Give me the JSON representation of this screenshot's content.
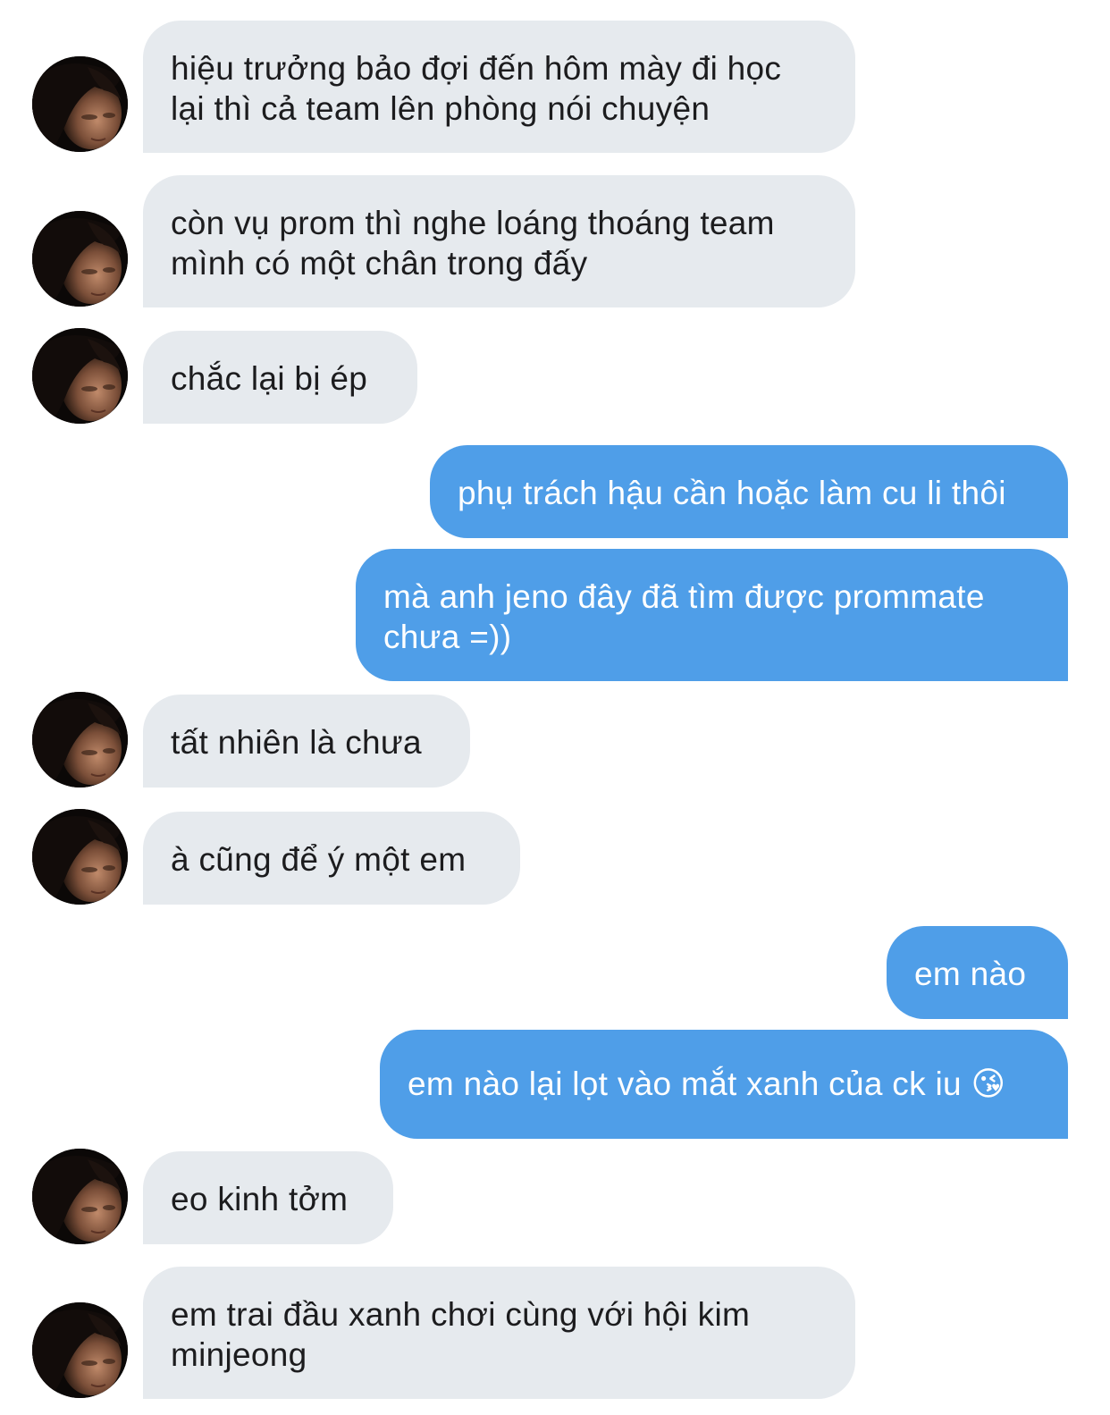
{
  "messages": [
    {
      "side": "in",
      "text": "hiệu trưởng bảo đợi đến hôm mày đi học\nlại thì cả team lên phòng nói chuyện"
    },
    {
      "side": "in",
      "text": "còn vụ prom thì nghe loáng thoáng team\nmình có một chân trong đấy"
    },
    {
      "side": "in",
      "text": "chắc lại bị ép"
    },
    {
      "side": "out",
      "text": "phụ trách hậu cần hoặc làm cu li thôi"
    },
    {
      "side": "out",
      "text": "mà anh jeno đây đã tìm được prommate\nchưa =))"
    },
    {
      "side": "in",
      "text": "tất nhiên là chưa"
    },
    {
      "side": "in",
      "text": "à cũng để ý một em"
    },
    {
      "side": "out",
      "text": "em nào"
    },
    {
      "side": "out",
      "text": "em nào lại lọt vào mắt xanh của ck iu 😘"
    },
    {
      "side": "in",
      "text": "eo kinh tởm"
    },
    {
      "side": "in",
      "text": "em trai đầu xanh chơi cùng với hội kim\nminjeong"
    }
  ],
  "colors": {
    "incoming_bubble": "#e6eaee",
    "outgoing_bubble": "#4f9ee8",
    "incoming_text": "#1c1c1e",
    "outgoing_text": "#ffffff"
  },
  "icons": {
    "contact_avatar": "avatar-photo"
  }
}
